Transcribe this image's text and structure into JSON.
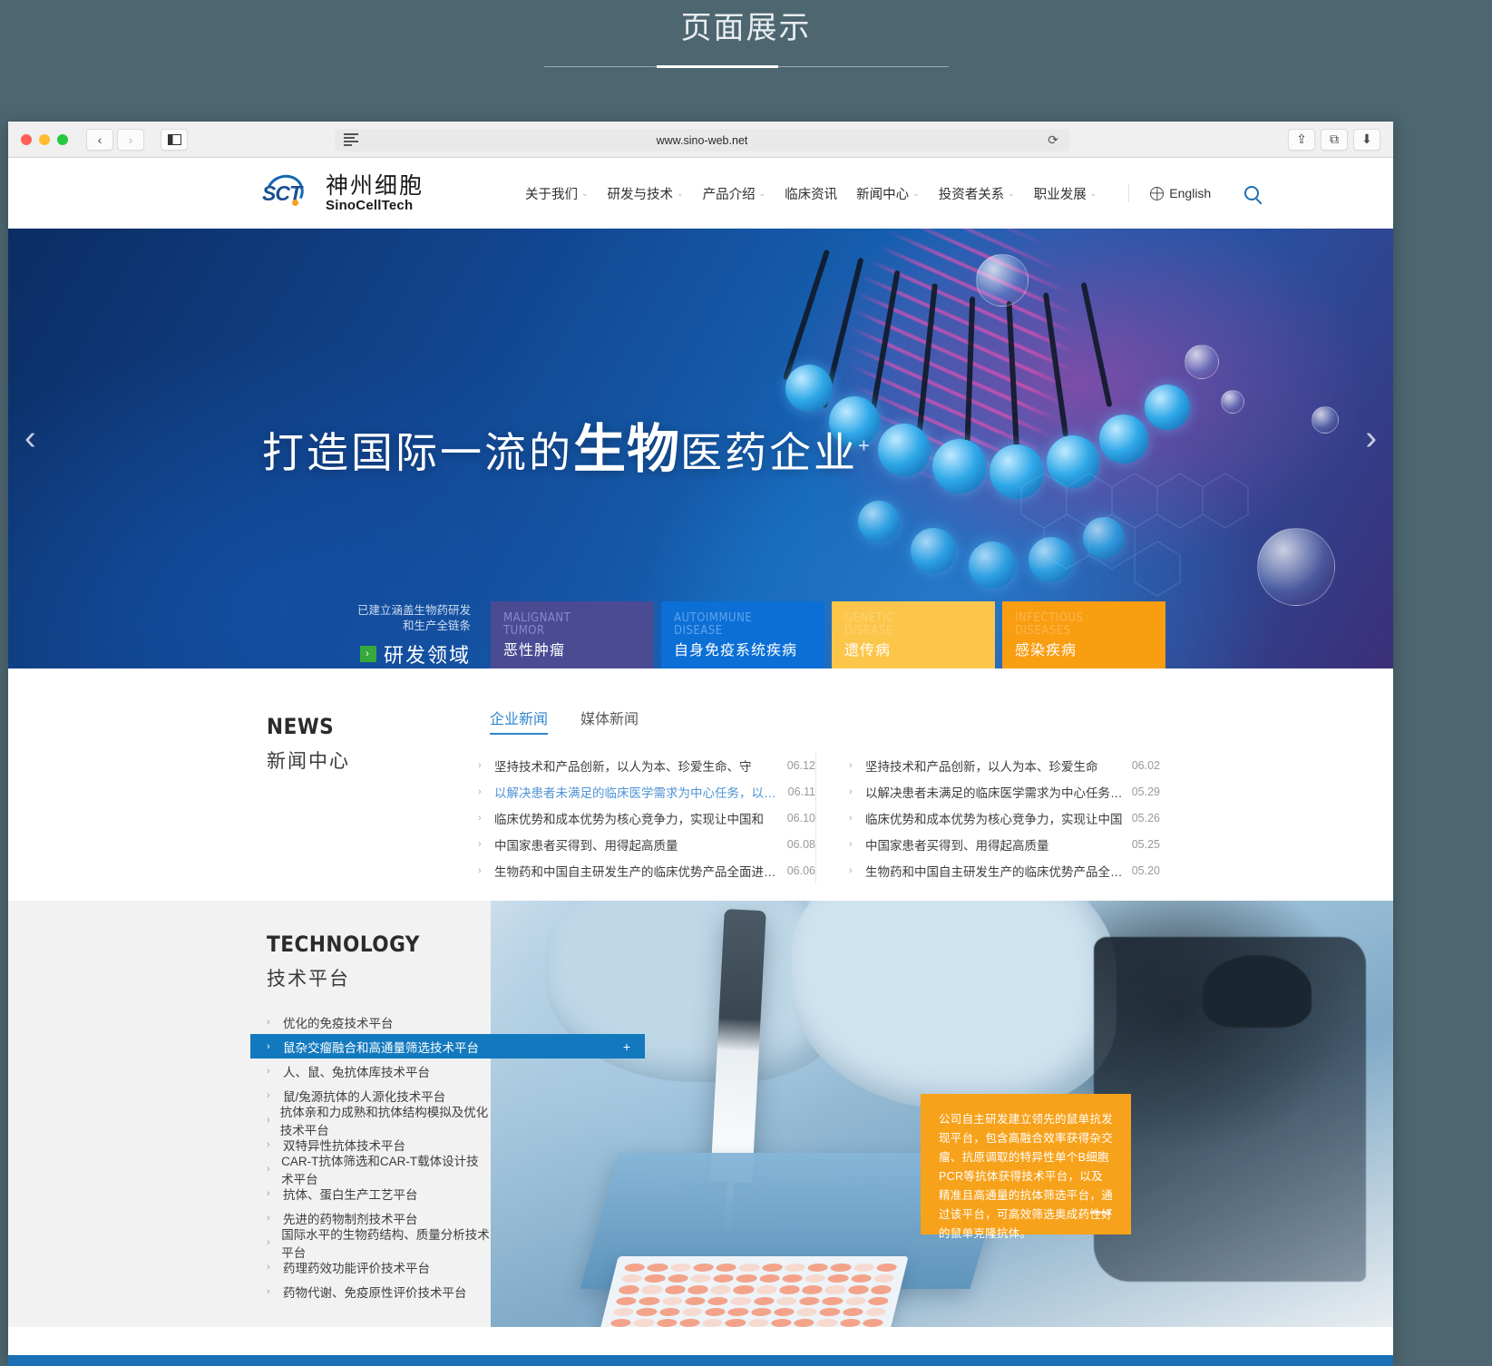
{
  "page": {
    "heading": "页面展示"
  },
  "browser": {
    "url": "www.sino-web.net",
    "back_label": "‹",
    "forward_label": "›",
    "sidebar_icon": "sidebar-icon",
    "reader_icon": "reader-view-icon",
    "reload_label": "⟳",
    "share_label": "⇪",
    "tabs_label": "⧉",
    "download_label": "⬇"
  },
  "site": {
    "logo": {
      "cn": "神州细胞",
      "en": "SinoCellTech",
      "mark": "SCT"
    },
    "nav": [
      {
        "label": "关于我们",
        "caret": "⌄"
      },
      {
        "label": "研发与技术",
        "caret": "⌄"
      },
      {
        "label": "产品介绍",
        "caret": "⌄"
      },
      {
        "label": "临床资讯",
        "caret": ""
      },
      {
        "label": "新闻中心",
        "caret": "⌄"
      },
      {
        "label": "投资者关系",
        "caret": "⌄"
      },
      {
        "label": "职业发展",
        "caret": "⌄"
      }
    ],
    "language": "English",
    "search_icon": "search-icon"
  },
  "hero": {
    "title_pre": "打造国际一流的",
    "title_brush": "生物",
    "title_post": "医药企业",
    "superscript": "+",
    "prev_arrow": "‹",
    "next_arrow": "›",
    "rd": {
      "line1": "已建立涵盖生物药研发",
      "line2": "和生产全链条",
      "cta": "研发领域",
      "chevron": "›"
    },
    "cards": [
      {
        "en": "MALIGNANT TUMOR",
        "en1": "MALIGNANT",
        "en2": "TUMOR",
        "cn": "恶性肿瘤",
        "color": "#4a4b93"
      },
      {
        "en": "AUTOIMMUNE DISEASE",
        "en1": "AUTOIMMUNE",
        "en2": "DISEASE",
        "cn": "自身免疫系统疾病",
        "color": "#0b6fd6"
      },
      {
        "en": "GENETIC DISEASE",
        "en1": "GENETIC",
        "en2": "DISEASE",
        "cn": "遗传病",
        "color": "#fcc64b"
      },
      {
        "en": "INFECTIOUS DISEASES",
        "en1": "INFECTIOUS",
        "en2": "DISEASES",
        "cn": "感染疾病",
        "color": "#f99d11"
      }
    ]
  },
  "news": {
    "heading_en": "NEWS",
    "heading_cn": "新闻中心",
    "tabs": [
      {
        "label": "企业新闻",
        "active": true
      },
      {
        "label": "媒体新闻",
        "active": false
      }
    ],
    "left_items": [
      {
        "chevron": "›",
        "title": "坚持技术和产品创新，以人为本、珍爱生命、守",
        "date": "06.12",
        "highlight": false
      },
      {
        "chevron": "›",
        "title": "以解决患者未满足的临床医学需求为中心任务，以产品",
        "date": "06.11",
        "highlight": true
      },
      {
        "chevron": "›",
        "title": "临床优势和成本优势为核心竞争力，实现让中国和",
        "date": "06.10",
        "highlight": false
      },
      {
        "chevron": "›",
        "title": "中国家患者买得到、用得起高质量",
        "date": "06.08",
        "highlight": false
      },
      {
        "chevron": "›",
        "title": "生物药和中国自主研发生产的临床优势产品全面进入发达国",
        "date": "06.06",
        "highlight": false
      }
    ],
    "right_items": [
      {
        "chevron": "›",
        "title": "坚持技术和产品创新，以人为本、珍爱生命",
        "date": "06.02",
        "highlight": false
      },
      {
        "chevron": "›",
        "title": "以解决患者未满足的临床医学需求为中心任务，以产",
        "date": "05.29",
        "highlight": false
      },
      {
        "chevron": "›",
        "title": "临床优势和成本优势为核心竞争力，实现让中国",
        "date": "05.26",
        "highlight": false
      },
      {
        "chevron": "›",
        "title": "中国家患者买得到、用得起高质量",
        "date": "05.25",
        "highlight": false
      },
      {
        "chevron": "›",
        "title": "生物药和中国自主研发生产的临床优势产品全面进入发",
        "date": "05.20",
        "highlight": false
      }
    ]
  },
  "technology": {
    "heading_en": "TECHNOLOGY",
    "heading_cn": "技术平台",
    "items": [
      {
        "chevron": "›",
        "label": "优化的免疫技术平台",
        "active": false
      },
      {
        "chevron": "›",
        "label": "鼠杂交瘤融合和高通量筛选技术平台",
        "active": true,
        "plus": "+"
      },
      {
        "chevron": "›",
        "label": "人、鼠、兔抗体库技术平台",
        "active": false
      },
      {
        "chevron": "›",
        "label": "鼠/兔源抗体的人源化技术平台",
        "active": false
      },
      {
        "chevron": "›",
        "label": "抗体亲和力成熟和抗体结构模拟及优化技术平台",
        "active": false
      },
      {
        "chevron": "›",
        "label": "双特异性抗体技术平台",
        "active": false
      },
      {
        "chevron": "›",
        "label": "CAR-T抗体筛选和CAR-T载体设计技术平台",
        "active": false
      },
      {
        "chevron": "›",
        "label": "抗体、蛋白生产工艺平台",
        "active": false
      },
      {
        "chevron": "›",
        "label": "先进的药物制剂技术平台",
        "active": false
      },
      {
        "chevron": "›",
        "label": "国际水平的生物药结构、质量分析技术平台",
        "active": false
      },
      {
        "chevron": "›",
        "label": "药理药效功能评价技术平台",
        "active": false
      },
      {
        "chevron": "›",
        "label": "药物代谢、免疫原性评价技术平台",
        "active": false
      }
    ],
    "callout": {
      "text": "公司自主研发建立领先的鼠单抗发现平台，包含高融合效率获得杂交瘤、抗原调取的特异性单个B细胞PCR等抗体获得技术平台，以及精准且高通量的抗体筛选平台，通过该平台，可高效筛选奥成药性好的鼠单克隆抗体。",
      "arrow": "⟶",
      "color": "#f7a21b"
    }
  },
  "colors": {
    "page_bg": "#4d6670",
    "accent_blue": "#1279bf",
    "link_blue": "#4e93d4",
    "orange": "#f7a21b",
    "green": "#37a93c"
  }
}
